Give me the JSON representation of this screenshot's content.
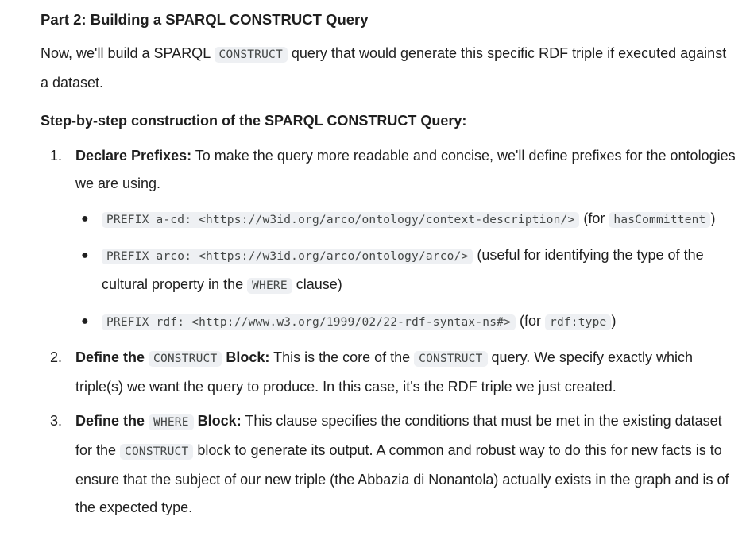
{
  "heading": "Part 2: Building a SPARQL CONSTRUCT Query",
  "intro": {
    "before": "Now, we'll build a SPARQL ",
    "code": "CONSTRUCT",
    "after": " query that would generate this specific RDF triple if executed against a dataset."
  },
  "subheading": "Step-by-step construction of the SPARQL CONSTRUCT Query:",
  "steps": [
    {
      "number": "1.",
      "title": "Declare Prefixes:",
      "text": " To make the query more readable and concise, we'll define prefixes for the ontologies we are using.",
      "prefixes": [
        {
          "code": "PREFIX a-cd: <https://w3id.org/arco/ontology/context-description/>",
          "before": " (for ",
          "code2": "hasCommittent",
          "after": ")"
        },
        {
          "code": "PREFIX arco: <https://w3id.org/arco/ontology/arco/>",
          "before": " (useful for identifying the type of the cultural property in the ",
          "code2": "WHERE",
          "after": " clause)"
        },
        {
          "code": "PREFIX rdf: <http://www.w3.org/1999/02/22-rdf-syntax-ns#>",
          "before": " (for ",
          "code2": "rdf:type",
          "after": ")"
        }
      ]
    },
    {
      "number": "2.",
      "title_before": "Define the ",
      "title_code": "CONSTRUCT",
      "title_after": " Block:",
      "text_before": " This is the core of the ",
      "text_code": "CONSTRUCT",
      "text_after": " query. We specify exactly which triple(s) we want the query to produce. In this case, it's the RDF triple we just created."
    },
    {
      "number": "3.",
      "title_before": "Define the ",
      "title_code": "WHERE",
      "title_after": " Block:",
      "text_before": " This clause specifies the conditions that must be met in the existing dataset for the ",
      "text_code": "CONSTRUCT",
      "text_after": " block to generate its output. A common and robust way to do this for new facts is to ensure that the subject of our new triple (the Abbazia di Nonantola) actually exists in the graph and is of the expected type."
    }
  ]
}
